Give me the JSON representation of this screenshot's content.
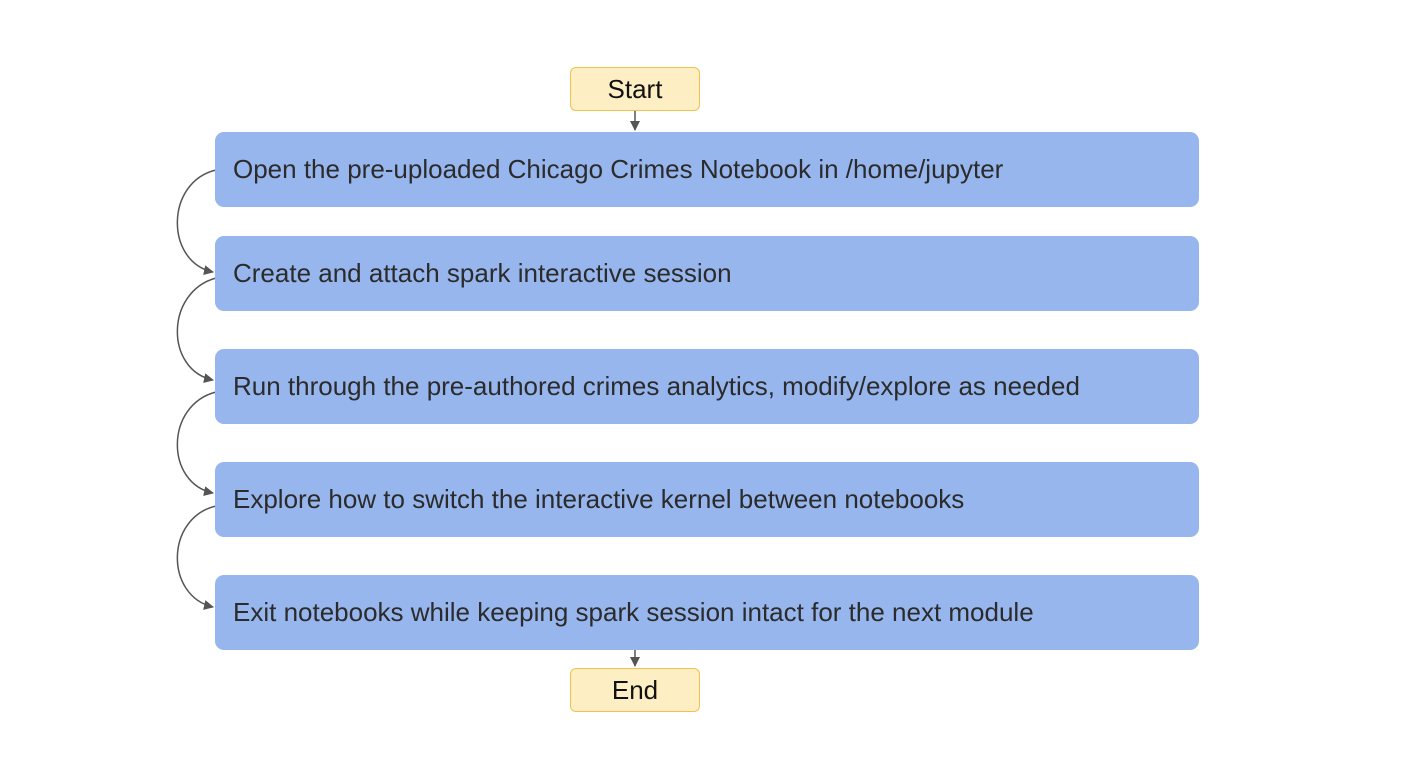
{
  "flow": {
    "start_label": "Start",
    "end_label": "End",
    "steps": [
      {
        "label": "Open the pre-uploaded Chicago Crimes Notebook in /home/jupyter"
      },
      {
        "label": "Create and attach spark interactive session"
      },
      {
        "label": "Run through the pre-authored crimes analytics, modify/explore as needed"
      },
      {
        "label": "Explore how to switch the interactive kernel between notebooks"
      },
      {
        "label": "Exit notebooks while keeping spark session intact for the next module"
      }
    ]
  },
  "colors": {
    "step_fill": "#97b6ee",
    "terminal_fill": "#fdefc3",
    "terminal_border": "#f2c14e",
    "connector": "#555555"
  }
}
